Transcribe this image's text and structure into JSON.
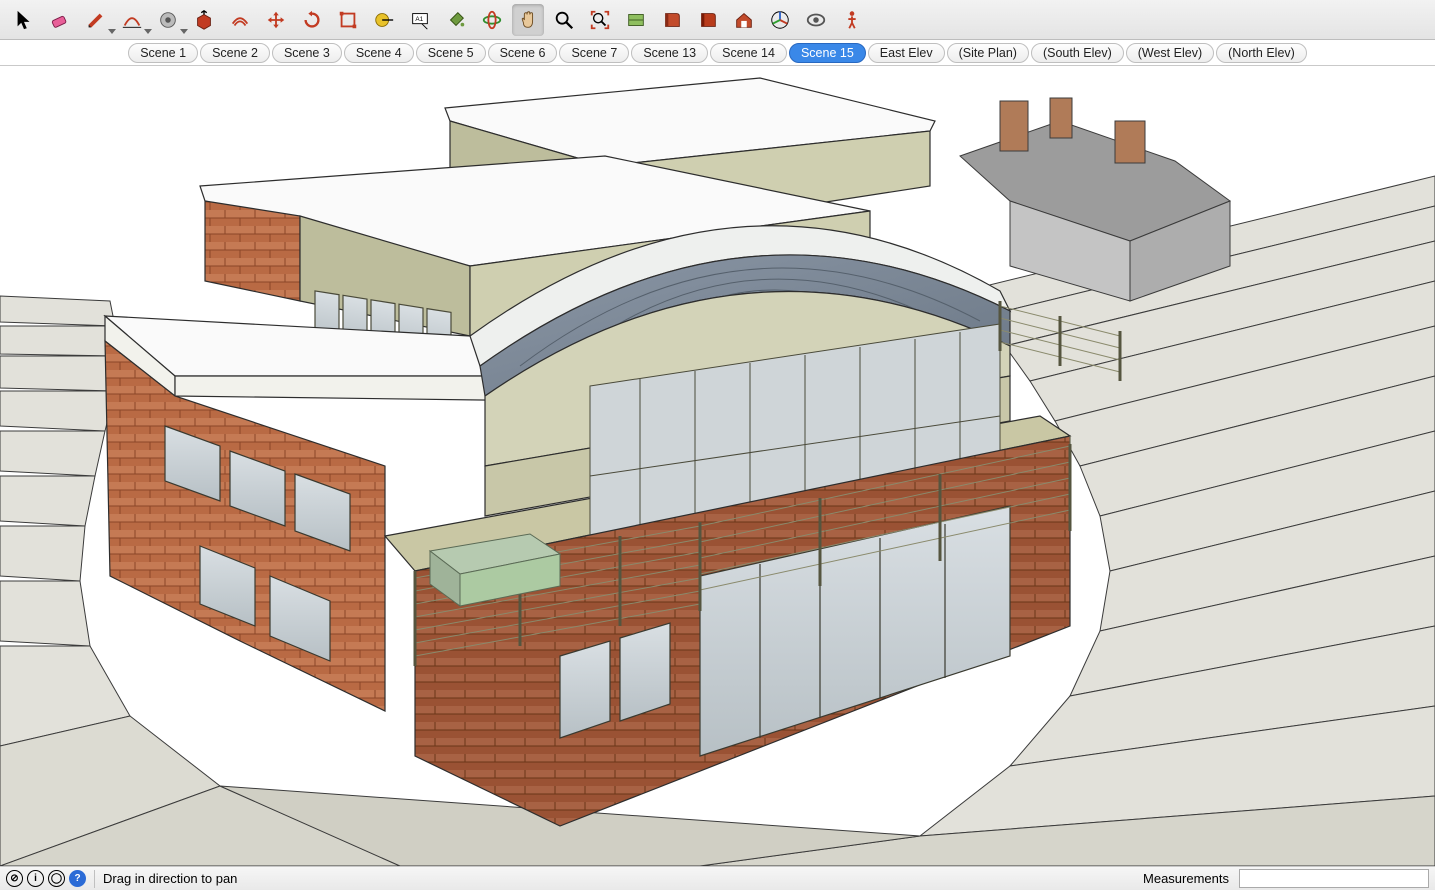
{
  "toolbar": {
    "tools": [
      {
        "name": "select-tool",
        "icon": "arrow",
        "dd": false
      },
      {
        "name": "eraser-tool",
        "icon": "eraser",
        "dd": false,
        "color": "#e85f98"
      },
      {
        "name": "pencil-tool",
        "icon": "pencil",
        "dd": true,
        "color": "#c23b22"
      },
      {
        "name": "arc-tool",
        "icon": "arc",
        "dd": true,
        "color": "#c23b22"
      },
      {
        "name": "protractor-tool",
        "icon": "protractor",
        "dd": true,
        "color": "#7b7b7b"
      },
      {
        "name": "push-pull-tool",
        "icon": "pushpull",
        "dd": false,
        "color": "#c23b22"
      },
      {
        "name": "offset-tool",
        "icon": "offset",
        "dd": false,
        "color": "#c23b22"
      },
      {
        "name": "move-tool",
        "icon": "move",
        "dd": false,
        "color": "#c23b22"
      },
      {
        "name": "rotate-tool",
        "icon": "rotate",
        "dd": false,
        "color": "#c23b22"
      },
      {
        "name": "scale-tool",
        "icon": "scale",
        "dd": false,
        "color": "#c23b22"
      },
      {
        "name": "tape-measure-tool",
        "icon": "tape",
        "dd": false,
        "color": "#d8a400"
      },
      {
        "name": "text-tool",
        "icon": "text",
        "dd": false
      },
      {
        "name": "paint-bucket-tool",
        "icon": "bucket",
        "dd": false,
        "color": "#4f7f20"
      },
      {
        "name": "orbit-tool",
        "icon": "orbit",
        "dd": false,
        "color": "#2e8f2e"
      },
      {
        "name": "pan-tool",
        "icon": "hand",
        "dd": false,
        "active": true
      },
      {
        "name": "zoom-tool",
        "icon": "zoom",
        "dd": false
      },
      {
        "name": "zoom-extents-tool",
        "icon": "zoom-extents",
        "dd": false,
        "color": "#c23b22"
      },
      {
        "name": "section-plane-tool",
        "icon": "section",
        "dd": false
      },
      {
        "name": "outliner-tool",
        "icon": "book",
        "dd": false,
        "color": "#c23b22"
      },
      {
        "name": "layers-tool",
        "icon": "book2",
        "dd": false,
        "color": "#c23b22"
      },
      {
        "name": "warehouse-tool",
        "icon": "warehouse",
        "dd": false,
        "color": "#c23b22"
      },
      {
        "name": "axes-tool",
        "icon": "axes",
        "dd": false
      },
      {
        "name": "styles-tool",
        "icon": "eye",
        "dd": false
      },
      {
        "name": "walk-tool",
        "icon": "person",
        "dd": false
      }
    ]
  },
  "scenes": {
    "tabs": [
      {
        "label": "Scene 1"
      },
      {
        "label": "Scene 2"
      },
      {
        "label": "Scene 3"
      },
      {
        "label": "Scene 4"
      },
      {
        "label": "Scene 5"
      },
      {
        "label": "Scene 6"
      },
      {
        "label": "Scene 7"
      },
      {
        "label": "Scene 13"
      },
      {
        "label": "Scene 14"
      },
      {
        "label": "Scene 15",
        "active": true
      },
      {
        "label": "East Elev"
      },
      {
        "label": "(Site Plan)"
      },
      {
        "label": "(South Elev)"
      },
      {
        "label": "(West Elev)"
      },
      {
        "label": "(North Elev)"
      }
    ]
  },
  "statusbar": {
    "hint": "Drag in direction to pan",
    "measurements_label": "Measurements",
    "measurements_value": ""
  },
  "text_label_icon": "A1"
}
